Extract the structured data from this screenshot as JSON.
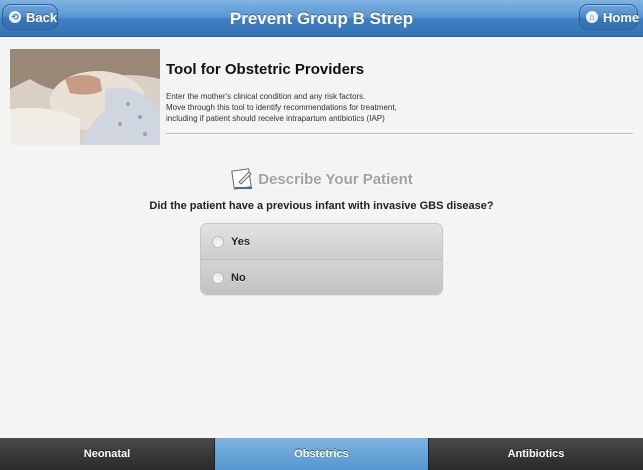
{
  "header": {
    "title": "Prevent Group B Strep",
    "back_label": "Back",
    "home_label": "Home"
  },
  "intro": {
    "title": "Tool for Obstetric Providers",
    "lines": [
      "Enter the mother's clinical condition and any risk factors.",
      "Move through this tool to identify recommendations for treatment,",
      "including if patient should receive intrapartum antibiotics (IAP)"
    ]
  },
  "section": {
    "title": "Describe Your Patient",
    "icon": "document-pencil-icon"
  },
  "question": {
    "text": "Did the patient have a previous infant with invasive GBS disease?",
    "options": [
      "Yes",
      "No"
    ]
  },
  "tabs": [
    {
      "label": "Neonatal",
      "active": false
    },
    {
      "label": "Obstetrics",
      "active": true
    },
    {
      "label": "Antibiotics",
      "active": false
    }
  ],
  "colors": {
    "header_blue": "#4d8acb",
    "active_tab": "#6aa5da",
    "tabbar_dark": "#333333",
    "section_title_gray": "#a2a2a2"
  }
}
